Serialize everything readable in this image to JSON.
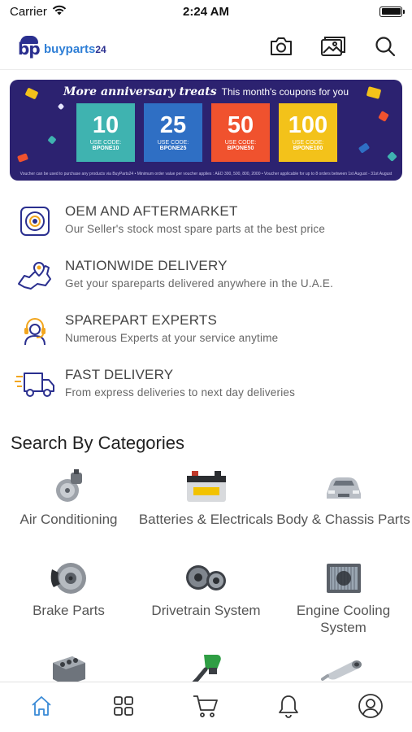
{
  "status_bar": {
    "carrier": "Carrier",
    "time": "2:24 AM"
  },
  "header": {
    "logo_mark": "bp",
    "logo_text": "buyparts",
    "logo_number": "24",
    "icons": [
      "camera-icon",
      "gallery-icon",
      "search-icon"
    ]
  },
  "banner": {
    "headline_italic": "More anniversary treats",
    "headline_rest": "This month's coupons for you",
    "coupons": [
      {
        "value": "10",
        "use": "USE CODE:",
        "code": "BPONE10",
        "color": "#3fb3b0"
      },
      {
        "value": "25",
        "use": "USE CODE:",
        "code": "BPONE25",
        "color": "#2f6fc4"
      },
      {
        "value": "50",
        "use": "USE CODE:",
        "code": "BPONE50",
        "color": "#f0522e"
      },
      {
        "value": "100",
        "use": "USE CODE:",
        "code": "BPONE100",
        "color": "#f3c21a"
      }
    ],
    "fineprint": "Voucher can be used to purchase any products via BuyParts24  •  Minimum order value per voucher applies : AED 300, 500, 800, 2000  •  Voucher applicable for up to 8 orders between 1st August - 31st August"
  },
  "features": [
    {
      "icon": "gear-disc-icon",
      "title": "OEM AND AFTERMARKET",
      "subtitle": "Our Seller's stock most spare parts at the best price"
    },
    {
      "icon": "uae-map-pin-icon",
      "title": "NATIONWIDE DELIVERY",
      "subtitle": "Get your spareparts delivered anywhere in the U.A.E."
    },
    {
      "icon": "headset-expert-icon",
      "title": "SPAREPART EXPERTS",
      "subtitle": "Numerous Experts at your service anytime"
    },
    {
      "icon": "delivery-truck-icon",
      "title": "FAST DELIVERY",
      "subtitle": "From express deliveries to next day deliveries"
    }
  ],
  "categories_title": "Search By Categories",
  "categories": [
    {
      "label": "Air Conditioning",
      "icon": "ac-compressor-icon"
    },
    {
      "label": "Batteries & Electricals",
      "icon": "battery-icon"
    },
    {
      "label": "Body & Chassis Parts",
      "icon": "car-body-icon"
    },
    {
      "label": "Brake Parts",
      "icon": "brake-disc-icon"
    },
    {
      "label": "Drivetrain System",
      "icon": "gears-icon"
    },
    {
      "label": "Engine Cooling System",
      "icon": "radiator-icon"
    },
    {
      "label": "",
      "icon": "engine-block-icon"
    },
    {
      "label": "",
      "icon": "fuel-nozzle-icon"
    },
    {
      "label": "",
      "icon": "exhaust-muffler-icon"
    }
  ],
  "tabs": [
    "home-icon",
    "categories-grid-icon",
    "cart-icon",
    "bell-icon",
    "profile-icon"
  ],
  "colors": {
    "accent": "#2f7fd6",
    "brand": "#2a2f8f",
    "feature_icon": "#2a2f8f",
    "feature_icon_accent": "#f2a61f",
    "active_tab": "#3a8ad6"
  }
}
